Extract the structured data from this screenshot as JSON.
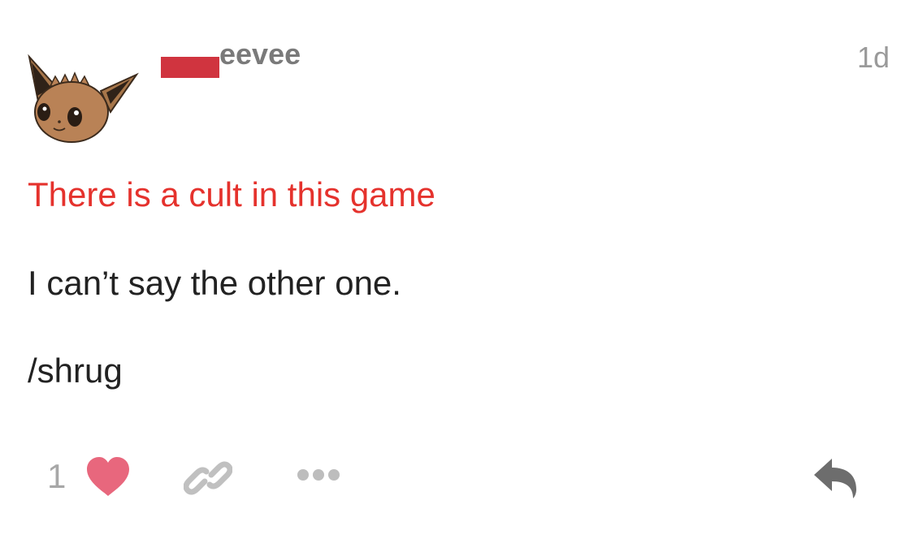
{
  "post": {
    "author": "eevee",
    "timestamp": "1d",
    "title": "There is a cult in this game",
    "body_lines": [
      "I can’t say the other one.",
      "/shrug"
    ]
  },
  "actions": {
    "like_count": "1",
    "icons": [
      "heart-icon",
      "link-icon",
      "more-icon",
      "reply-icon"
    ]
  },
  "colors": {
    "title": "#e5322d",
    "heart": "#e8677d",
    "redaction": "#d0343f",
    "muted": "#a7a7a7"
  }
}
